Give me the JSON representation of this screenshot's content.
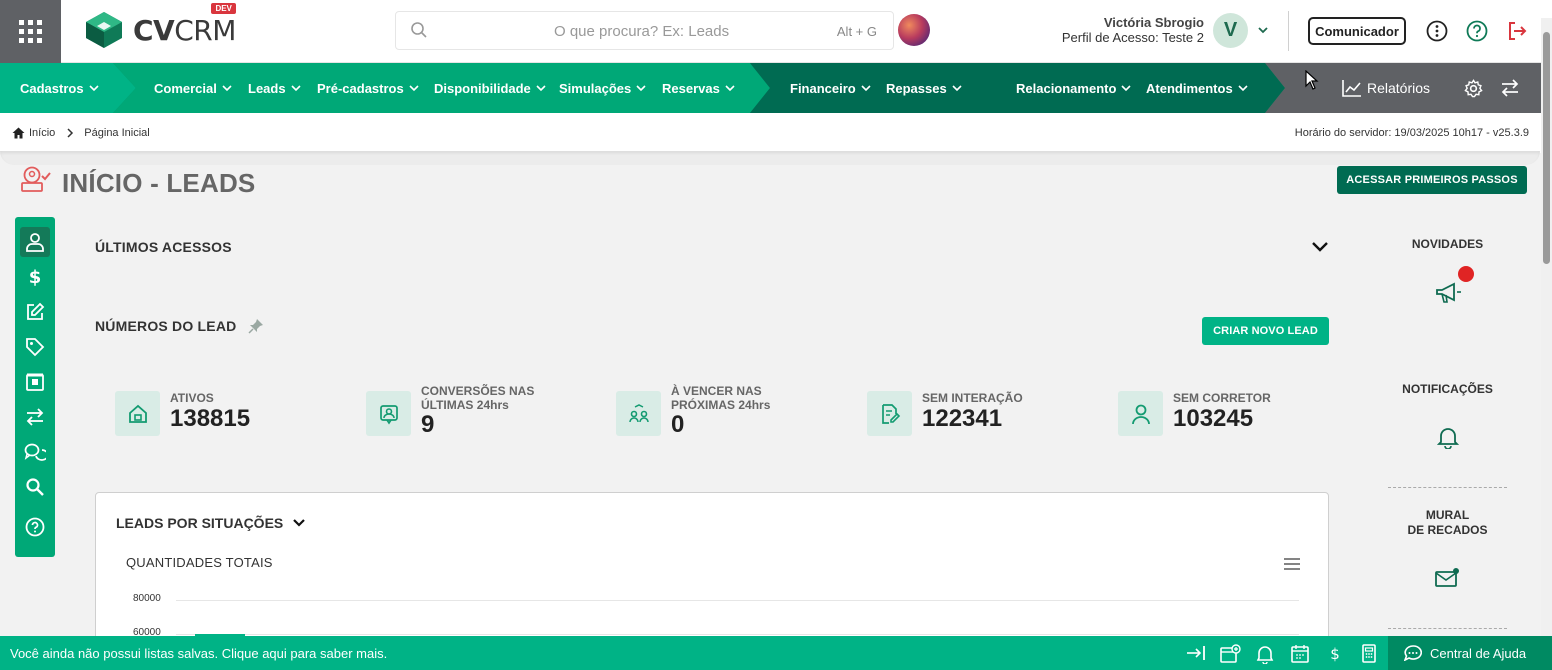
{
  "header": {
    "logo_text_bold": "CV",
    "logo_text_light": "CRM",
    "dev_badge": "DEV",
    "search_placeholder": "O que procura? Ex: Leads",
    "search_shortcut": "Alt + G",
    "user_name": "Victória Sbrogio",
    "user_profile": "Perfil de Acesso: Teste 2",
    "avatar_letter": "V",
    "comunicador_label": "Comunicador"
  },
  "nav": {
    "items": [
      {
        "label": "Cadastros"
      },
      {
        "label": "Comercial"
      },
      {
        "label": "Leads"
      },
      {
        "label": "Pré-cadastros"
      },
      {
        "label": "Disponibilidade"
      },
      {
        "label": "Simulações"
      },
      {
        "label": "Reservas"
      },
      {
        "label": "Financeiro"
      },
      {
        "label": "Repasses"
      },
      {
        "label": "Relacionamento"
      },
      {
        "label": "Atendimentos"
      },
      {
        "label": "Relatórios"
      }
    ],
    "colors": {
      "light": "#00b386",
      "mid": "#008a62",
      "dark": "#006b52",
      "grey": "#5f6165"
    }
  },
  "breadcrumb": {
    "home": "Início",
    "current": "Página Inicial",
    "server_time": "Horário do servidor: 19/03/2025 10h17 - v25.3.9"
  },
  "page": {
    "title": "INÍCIO - LEADS",
    "first_steps_button": "ACESSAR PRIMEIROS PASSOS",
    "recent_access": "ÚLTIMOS ACESSOS",
    "lead_numbers": "NÚMEROS DO LEAD",
    "new_lead_button": "CRIAR NOVO LEAD"
  },
  "stats": [
    {
      "label1": "ATIVOS",
      "label2": "",
      "value": "138815",
      "icon": "house-icon"
    },
    {
      "label1": "CONVERSÕES NAS",
      "label2": "ÚLTIMAS 24hrs",
      "value": "9",
      "icon": "person-badge-icon"
    },
    {
      "label1": "À VENCER NAS",
      "label2": "PRÓXIMAS 24hrs",
      "value": "0",
      "icon": "people-swap-icon"
    },
    {
      "label1": "SEM INTERAÇÃO",
      "label2": "",
      "value": "122341",
      "icon": "document-edit-icon"
    },
    {
      "label1": "SEM CORRETOR",
      "label2": "",
      "value": "103245",
      "icon": "person-icon"
    }
  ],
  "chart_panel": {
    "heading": "LEADS POR SITUAÇÕES",
    "chart_title": "QUANTIDADES TOTAIS"
  },
  "chart_data": {
    "type": "bar",
    "title": "QUANTIDADES TOTAIS",
    "y_ticks": [
      "80000",
      "60000"
    ]
  },
  "right_column": {
    "novidades": "NOVIDADES",
    "notificacoes": "NOTIFICAÇÕES",
    "mural_line1": "MURAL",
    "mural_line2": "DE RECADOS"
  },
  "footer": {
    "message": "Você ainda não possui listas salvas. Clique aqui para saber mais.",
    "help_label": "Central de Ajuda"
  }
}
